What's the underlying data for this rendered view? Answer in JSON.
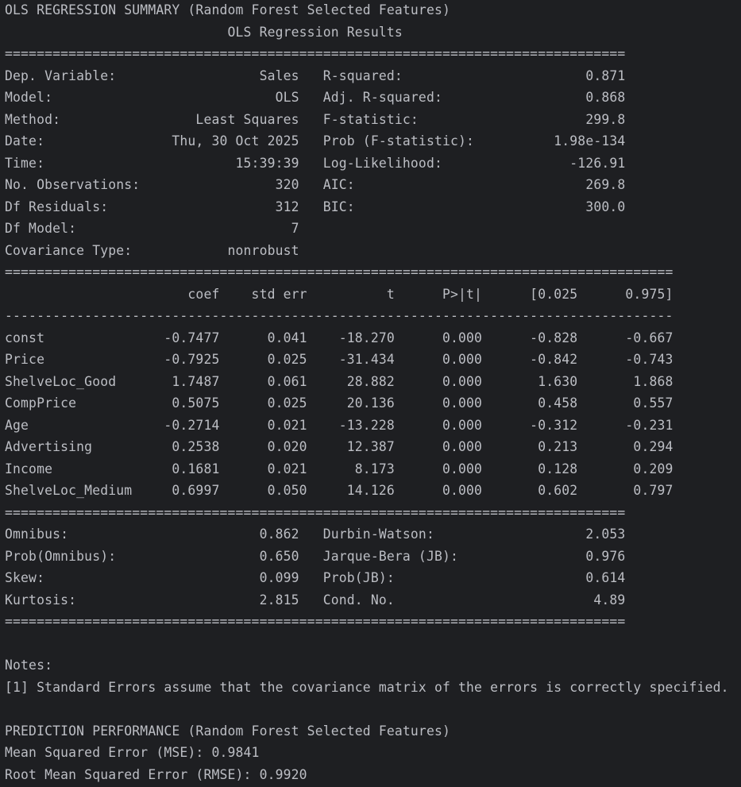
{
  "console": {
    "lines": [
      "OLS REGRESSION SUMMARY (Random Forest Selected Features)",
      "                            OLS Regression Results                            ",
      "==============================================================================",
      "Dep. Variable:                  Sales   R-squared:                       0.871",
      "Model:                            OLS   Adj. R-squared:                  0.868",
      "Method:                 Least Squares   F-statistic:                     299.8",
      "Date:                Thu, 30 Oct 2025   Prob (F-statistic):          1.98e-134",
      "Time:                        15:39:39   Log-Likelihood:                -126.91",
      "No. Observations:                 320   AIC:                             269.8",
      "Df Residuals:                     312   BIC:                             300.0",
      "Df Model:                           7                                         ",
      "Covariance Type:            nonrobust                                         ",
      "====================================================================================",
      "                       coef    std err          t      P>|t|      [0.025      0.975]",
      "------------------------------------------------------------------------------------",
      "const               -0.7477      0.041    -18.270      0.000      -0.828      -0.667",
      "Price               -0.7925      0.025    -31.434      0.000      -0.842      -0.743",
      "ShelveLoc_Good       1.7487      0.061     28.882      0.000       1.630       1.868",
      "CompPrice            0.5075      0.025     20.136      0.000       0.458       0.557",
      "Age                 -0.2714      0.021    -13.228      0.000      -0.312      -0.231",
      "Advertising          0.2538      0.020     12.387      0.000       0.213       0.294",
      "Income               0.1681      0.021      8.173      0.000       0.128       0.209",
      "ShelveLoc_Medium     0.6997      0.050     14.126      0.000       0.602       0.797",
      "==============================================================================",
      "Omnibus:                        0.862   Durbin-Watson:                   2.053",
      "Prob(Omnibus):                  0.650   Jarque-Bera (JB):                0.976",
      "Skew:                           0.099   Prob(JB):                        0.614",
      "Kurtosis:                       2.815   Cond. No.                         4.89",
      "==============================================================================",
      "",
      "Notes:",
      "[1] Standard Errors assume that the covariance matrix of the errors is correctly specified.",
      "",
      "PREDICTION PERFORMANCE (Random Forest Selected Features)",
      "Mean Squared Error (MSE): 0.9841",
      "Root Mean Squared Error (RMSE): 0.9920"
    ]
  }
}
